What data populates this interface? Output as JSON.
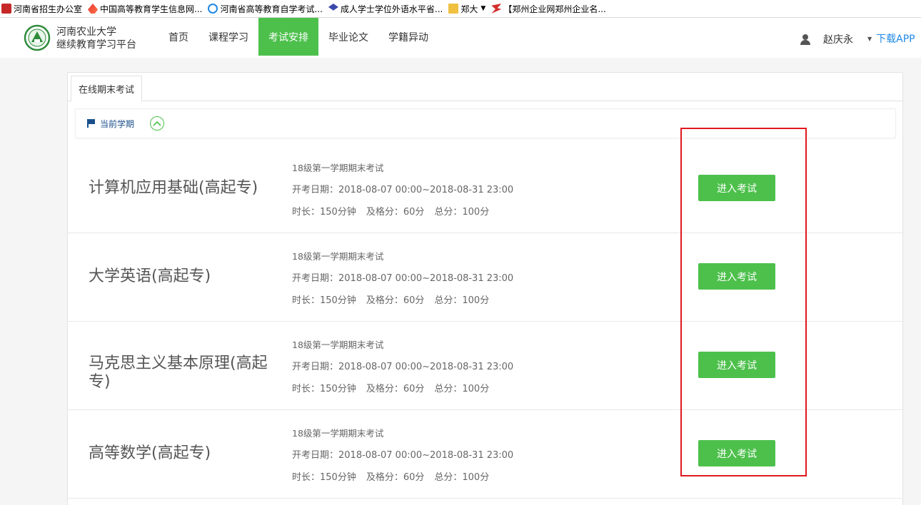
{
  "bookmarks": [
    {
      "label": "河南省招生办公室",
      "icon": "red-badge-icon"
    },
    {
      "label": "中国高等教育学生信息网...",
      "icon": "flame-icon"
    },
    {
      "label": "河南省高等教育自学考试...",
      "icon": "ie-icon"
    },
    {
      "label": "成人学士学位外语水平省...",
      "icon": "graduation-cap-icon"
    },
    {
      "label": "郑大",
      "icon": "folder-icon"
    },
    {
      "label": "【郑州企业网郑州企业名...",
      "icon": "zz-logo-icon"
    }
  ],
  "header": {
    "brand_line1": "河南农业大学",
    "brand_line2": "继续教育学习平台",
    "nav": [
      "首页",
      "课程学习",
      "考试安排",
      "毕业论文",
      "学籍异动"
    ],
    "active_nav": "考试安排",
    "user_name": "赵庆永",
    "download_label": "下载APP"
  },
  "tabs": [
    "在线期末考试"
  ],
  "term_label": "当前学期",
  "courses": [
    {
      "name": "计算机应用基础(高起专)",
      "batch": "18级第一学期期末考试",
      "date_label": "开考日期：2018-08-07 00:00~2018-08-31 23:00",
      "duration": "时长：150分钟",
      "pass": "及格分：60分",
      "total": "总分：100分",
      "button": "进入考试"
    },
    {
      "name": "大学英语(高起专)",
      "batch": "18级第一学期期末考试",
      "date_label": "开考日期：2018-08-07 00:00~2018-08-31 23:00",
      "duration": "时长：150分钟",
      "pass": "及格分：60分",
      "total": "总分：100分",
      "button": "进入考试"
    },
    {
      "name": "马克思主义基本原理(高起专)",
      "batch": "18级第一学期期末考试",
      "date_label": "开考日期：2018-08-07 00:00~2018-08-31 23:00",
      "duration": "时长：150分钟",
      "pass": "及格分：60分",
      "total": "总分：100分",
      "button": "进入考试"
    },
    {
      "name": "高等数学(高起专)",
      "batch": "18级第一学期期末考试",
      "date_label": "开考日期：2018-08-07 00:00~2018-08-31 23:00",
      "duration": "时长：150分钟",
      "pass": "及格分：60分",
      "total": "总分：100分",
      "button": "进入考试"
    }
  ],
  "colors": {
    "accent": "#4dc04c",
    "link": "#1e88e5",
    "highlight": "#e0181f"
  }
}
